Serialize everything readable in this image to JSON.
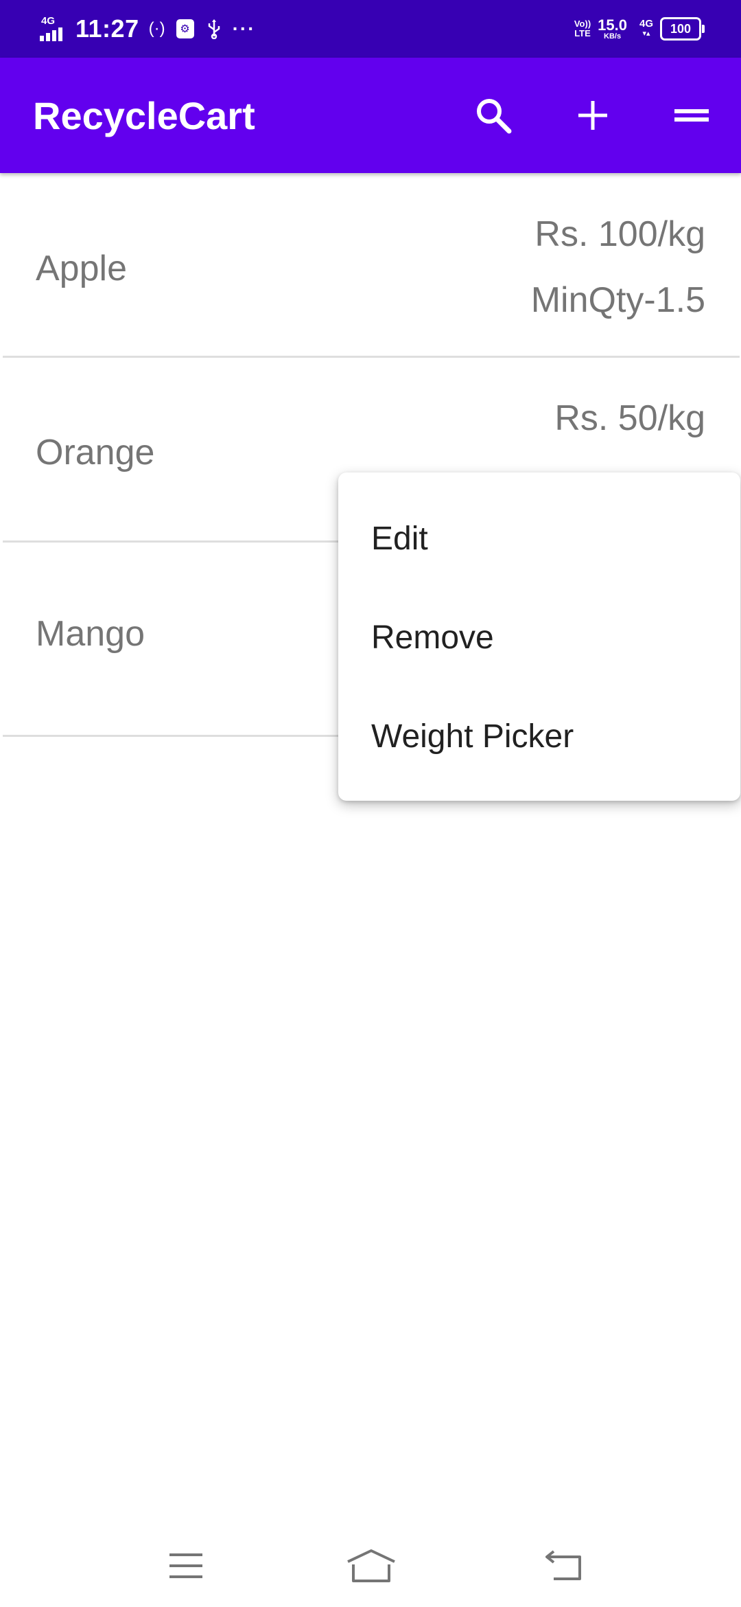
{
  "status_bar": {
    "network_type": "4G",
    "time": "11:27",
    "hotspot_icon": "(·)",
    "usb_label": "⚙",
    "overflow": "···",
    "volte_line1": "Vo))",
    "volte_line2": "LTE",
    "speed_value": "15.0",
    "speed_unit": "KB/s",
    "data_type": "4G",
    "data_arrows": "▾▴",
    "battery_level": "100"
  },
  "app_bar": {
    "title": "RecycleCart",
    "background": "#6200ee",
    "status_background": "#3700b3",
    "actions": [
      "search-icon",
      "add-icon",
      "menu-icon"
    ]
  },
  "items": [
    {
      "name": "Apple",
      "price": "Rs. 100/kg",
      "min_qty": "MinQty-1.5"
    },
    {
      "name": "Orange",
      "price": "Rs. 50/kg",
      "min_qty": ""
    },
    {
      "name": "Mango",
      "price": "",
      "min_qty": ""
    }
  ],
  "popup_menu": {
    "items": [
      "Edit",
      "Remove",
      "Weight Picker"
    ]
  },
  "nav_bar": {
    "buttons": [
      "recent-apps-icon",
      "home-icon",
      "back-icon"
    ]
  }
}
